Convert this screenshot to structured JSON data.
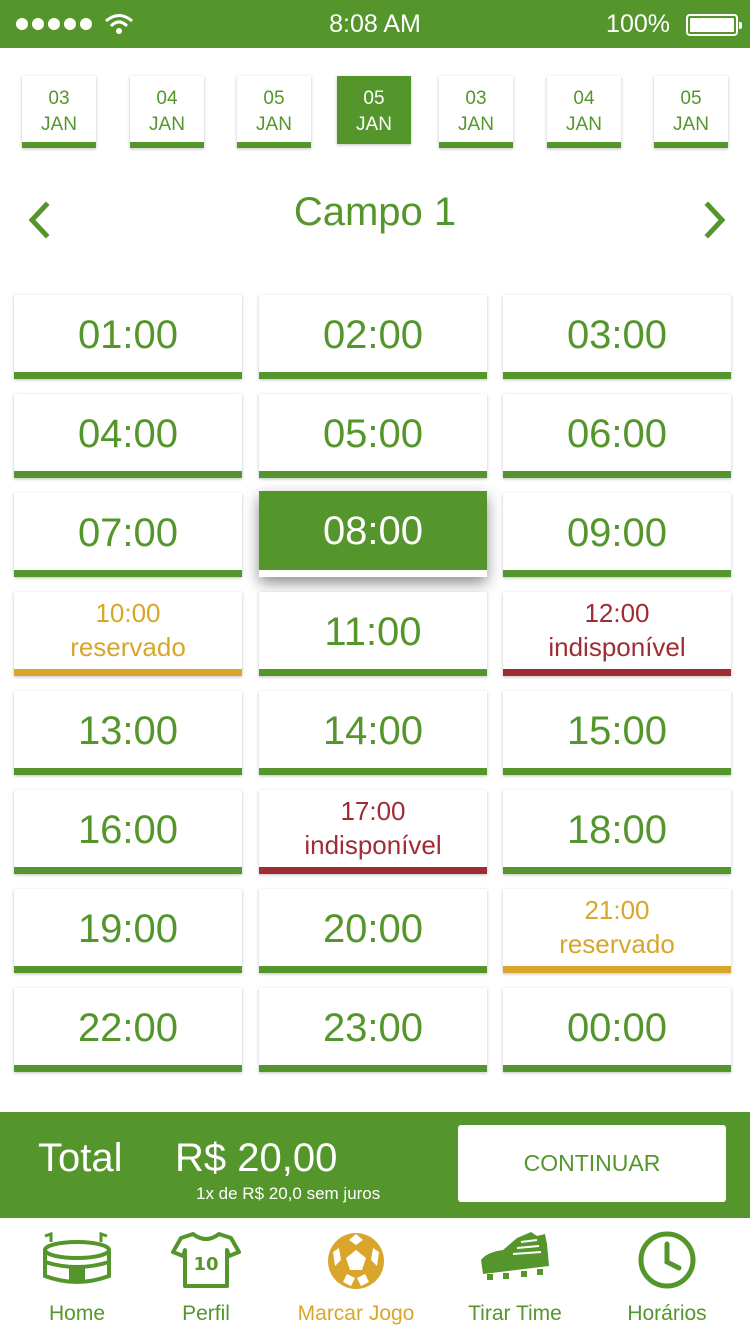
{
  "status_bar": {
    "time": "8:08 AM",
    "battery": "100%"
  },
  "dates": [
    {
      "day": "03",
      "month": "JAN",
      "active": false
    },
    {
      "day": "04",
      "month": "JAN",
      "active": false
    },
    {
      "day": "05",
      "month": "JAN",
      "active": false
    },
    {
      "day": "05",
      "month": "JAN",
      "active": true
    },
    {
      "day": "03",
      "month": "JAN",
      "active": false
    },
    {
      "day": "04",
      "month": "JAN",
      "active": false
    },
    {
      "day": "05",
      "month": "JAN",
      "active": false
    }
  ],
  "field": {
    "title": "Campo 1"
  },
  "slots": [
    {
      "time": "01:00",
      "status": "available",
      "label": ""
    },
    {
      "time": "02:00",
      "status": "available",
      "label": ""
    },
    {
      "time": "03:00",
      "status": "available",
      "label": ""
    },
    {
      "time": "04:00",
      "status": "available",
      "label": ""
    },
    {
      "time": "05:00",
      "status": "available",
      "label": ""
    },
    {
      "time": "06:00",
      "status": "available",
      "label": ""
    },
    {
      "time": "07:00",
      "status": "available",
      "label": ""
    },
    {
      "time": "08:00",
      "status": "selected",
      "label": ""
    },
    {
      "time": "09:00",
      "status": "available",
      "label": ""
    },
    {
      "time": "10:00",
      "status": "reserved",
      "label": "reservado"
    },
    {
      "time": "11:00",
      "status": "available",
      "label": ""
    },
    {
      "time": "12:00",
      "status": "unavailable",
      "label": "indisponível"
    },
    {
      "time": "13:00",
      "status": "available",
      "label": ""
    },
    {
      "time": "14:00",
      "status": "available",
      "label": ""
    },
    {
      "time": "15:00",
      "status": "available",
      "label": ""
    },
    {
      "time": "16:00",
      "status": "available",
      "label": ""
    },
    {
      "time": "17:00",
      "status": "unavailable",
      "label": "indisponível"
    },
    {
      "time": "18:00",
      "status": "available",
      "label": ""
    },
    {
      "time": "19:00",
      "status": "available",
      "label": ""
    },
    {
      "time": "20:00",
      "status": "available",
      "label": ""
    },
    {
      "time": "21:00",
      "status": "reserved",
      "label": "reservado"
    },
    {
      "time": "22:00",
      "status": "available",
      "label": ""
    },
    {
      "time": "23:00",
      "status": "available",
      "label": ""
    },
    {
      "time": "00:00",
      "status": "available",
      "label": ""
    }
  ],
  "total": {
    "label": "Total",
    "price": "R$ 20,00",
    "installments": "1x de R$ 20,0 sem juros",
    "continue_label": "CONTINUAR"
  },
  "nav": [
    {
      "label": "Home",
      "icon": "stadium-icon",
      "active": false
    },
    {
      "label": "Perfil",
      "icon": "jersey-icon",
      "active": false
    },
    {
      "label": "Marcar Jogo",
      "icon": "soccer-ball-icon",
      "active": true
    },
    {
      "label": "Tirar Time",
      "icon": "soccer-cleat-icon",
      "active": false
    },
    {
      "label": "Horários",
      "icon": "clock-icon",
      "active": false
    }
  ],
  "colors": {
    "primary": "#54962b",
    "reserved": "#d9a52a",
    "unavailable": "#a02c33"
  }
}
